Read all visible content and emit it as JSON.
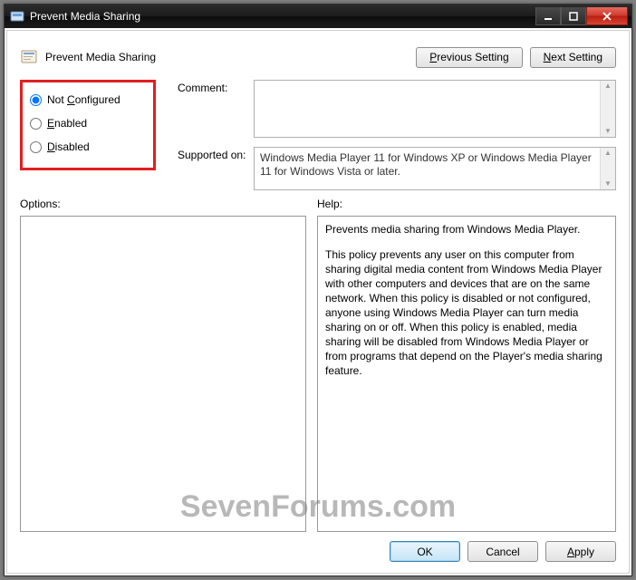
{
  "window": {
    "title": "Prevent Media Sharing"
  },
  "header": {
    "title": "Prevent Media Sharing",
    "prev_label_pre": "",
    "prev_key": "P",
    "prev_rest": "revious Setting",
    "next_label_pre": "",
    "next_key": "N",
    "next_rest": "ext Setting"
  },
  "state": {
    "not_configured_pre": "Not ",
    "not_configured_key": "C",
    "not_configured_rest": "onfigured",
    "enabled_key": "E",
    "enabled_rest": "nabled",
    "disabled_key": "D",
    "disabled_rest": "isabled",
    "selected": "not_configured"
  },
  "labels": {
    "comment": "Comment:",
    "supported_on": "Supported on:",
    "options": "Options:",
    "help": "Help:"
  },
  "supported_text": "Windows Media Player 11 for Windows XP or Windows Media Player 11 for Windows Vista or later.",
  "help_text_p1": "Prevents media sharing from Windows Media Player.",
  "help_text_p2": "This policy prevents any user on this computer from sharing digital media content from Windows Media Player with other computers and devices that are on the same network. When this policy is disabled or not configured, anyone using Windows Media Player can turn media sharing on or off. When this policy is enabled, media sharing will be disabled from Windows Media Player or from programs that depend on the Player's media sharing feature.",
  "footer": {
    "ok": "OK",
    "cancel": "Cancel",
    "apply_key": "A",
    "apply_rest": "pply"
  },
  "watermark": "SevenForums.com"
}
